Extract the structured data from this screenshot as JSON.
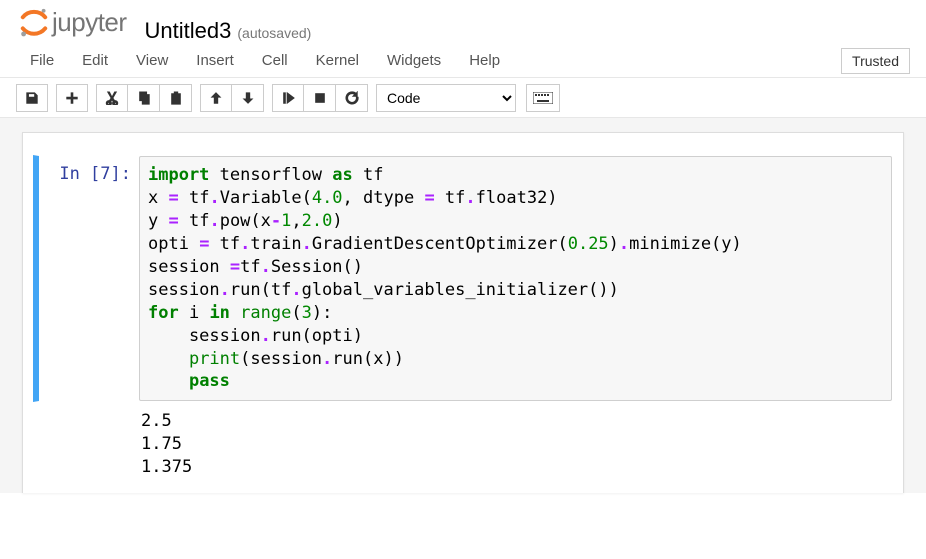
{
  "header": {
    "logo_text": "jupyter",
    "title": "Untitled3",
    "autosave": "(autosaved)"
  },
  "menu": {
    "items": [
      "File",
      "Edit",
      "View",
      "Insert",
      "Cell",
      "Kernel",
      "Widgets",
      "Help"
    ],
    "trusted": "Trusted"
  },
  "toolbar": {
    "celltype_selected": "Code",
    "icons": {
      "save": "save-icon",
      "add": "plus-icon",
      "cut": "cut-icon",
      "copy": "copy-icon",
      "paste": "paste-icon",
      "up": "arrow-up-icon",
      "down": "arrow-down-icon",
      "run": "run-icon",
      "stop": "stop-icon",
      "restart": "restart-icon",
      "cmd": "keyboard-icon"
    }
  },
  "cell": {
    "prompt": "In [7]:",
    "code_tokens": [
      [
        {
          "t": "import",
          "c": "kw"
        },
        {
          "t": " tensorflow ",
          "c": "nm"
        },
        {
          "t": "as",
          "c": "kw"
        },
        {
          "t": " tf",
          "c": "nm"
        }
      ],
      [
        {
          "t": "x ",
          "c": "nm"
        },
        {
          "t": "=",
          "c": "op"
        },
        {
          "t": " tf",
          "c": "nm"
        },
        {
          "t": ".",
          "c": "op"
        },
        {
          "t": "Variable(",
          "c": "nm"
        },
        {
          "t": "4.0",
          "c": "num"
        },
        {
          "t": ", dtype ",
          "c": "nm"
        },
        {
          "t": "=",
          "c": "op"
        },
        {
          "t": " tf",
          "c": "nm"
        },
        {
          "t": ".",
          "c": "op"
        },
        {
          "t": "float32)",
          "c": "nm"
        }
      ],
      [
        {
          "t": "y ",
          "c": "nm"
        },
        {
          "t": "=",
          "c": "op"
        },
        {
          "t": " tf",
          "c": "nm"
        },
        {
          "t": ".",
          "c": "op"
        },
        {
          "t": "pow(x",
          "c": "nm"
        },
        {
          "t": "-",
          "c": "op"
        },
        {
          "t": "1",
          "c": "num"
        },
        {
          "t": ",",
          "c": "nm"
        },
        {
          "t": "2.0",
          "c": "num"
        },
        {
          "t": ")",
          "c": "nm"
        }
      ],
      [
        {
          "t": "opti ",
          "c": "nm"
        },
        {
          "t": "=",
          "c": "op"
        },
        {
          "t": " tf",
          "c": "nm"
        },
        {
          "t": ".",
          "c": "op"
        },
        {
          "t": "train",
          "c": "nm"
        },
        {
          "t": ".",
          "c": "op"
        },
        {
          "t": "GradientDescentOptimizer(",
          "c": "nm"
        },
        {
          "t": "0.25",
          "c": "num"
        },
        {
          "t": ")",
          "c": "nm"
        },
        {
          "t": ".",
          "c": "op"
        },
        {
          "t": "minimize(y)",
          "c": "nm"
        }
      ],
      [
        {
          "t": "session ",
          "c": "nm"
        },
        {
          "t": "=",
          "c": "op"
        },
        {
          "t": "tf",
          "c": "nm"
        },
        {
          "t": ".",
          "c": "op"
        },
        {
          "t": "Session()",
          "c": "nm"
        }
      ],
      [
        {
          "t": "session",
          "c": "nm"
        },
        {
          "t": ".",
          "c": "op"
        },
        {
          "t": "run(tf",
          "c": "nm"
        },
        {
          "t": ".",
          "c": "op"
        },
        {
          "t": "global_variables_initializer())",
          "c": "nm"
        }
      ],
      [
        {
          "t": "for",
          "c": "kw"
        },
        {
          "t": " i ",
          "c": "nm"
        },
        {
          "t": "in",
          "c": "kw"
        },
        {
          "t": " ",
          "c": "nm"
        },
        {
          "t": "range",
          "c": "bn"
        },
        {
          "t": "(",
          "c": "nm"
        },
        {
          "t": "3",
          "c": "num"
        },
        {
          "t": "):",
          "c": "nm"
        }
      ],
      [
        {
          "t": "    session",
          "c": "nm"
        },
        {
          "t": ".",
          "c": "op"
        },
        {
          "t": "run(opti)",
          "c": "nm"
        }
      ],
      [
        {
          "t": "    ",
          "c": "nm"
        },
        {
          "t": "print",
          "c": "bn"
        },
        {
          "t": "(session",
          "c": "nm"
        },
        {
          "t": ".",
          "c": "op"
        },
        {
          "t": "run(x))",
          "c": "nm"
        }
      ],
      [
        {
          "t": "    ",
          "c": "nm"
        },
        {
          "t": "pass",
          "c": "pass"
        }
      ]
    ],
    "output": "2.5\n1.75\n1.375"
  }
}
